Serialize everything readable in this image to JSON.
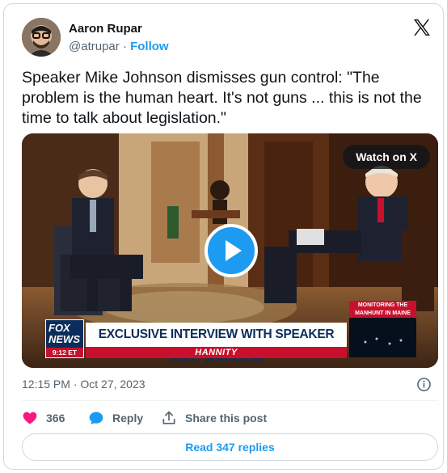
{
  "author": {
    "name": "Aaron Rupar",
    "handle": "@atrupar",
    "separator": "·",
    "follow_label": "Follow"
  },
  "tweet": {
    "text": "Speaker Mike Johnson dismisses gun control: \"The problem is the human heart. It's not guns ... this is not the time to talk about legislation.\"",
    "timestamp": "12:15 PM · Oct 27, 2023"
  },
  "media": {
    "watch_label": "Watch on X",
    "chyron_main": "EXCLUSIVE INTERVIEW WITH SPEAKER MIKE JOHNSON",
    "chyron_sub": "HANNITY",
    "network_line1": "FOX",
    "network_line2": "NEWS",
    "network_time": "9:12 ET",
    "side_box_label": "MONITORING THE MANHUNT IN MAINE"
  },
  "actions": {
    "likes_count": "366",
    "reply_label": "Reply",
    "share_label": "Share this post"
  },
  "read_replies_label": "Read 347 replies",
  "colors": {
    "accent": "#1d9bf0",
    "like": "#f91880",
    "text": "#0f1419",
    "secondary": "#536471"
  },
  "icons": [
    "x-logo-icon",
    "play-icon",
    "info-icon",
    "heart-icon",
    "reply-icon",
    "share-icon"
  ]
}
